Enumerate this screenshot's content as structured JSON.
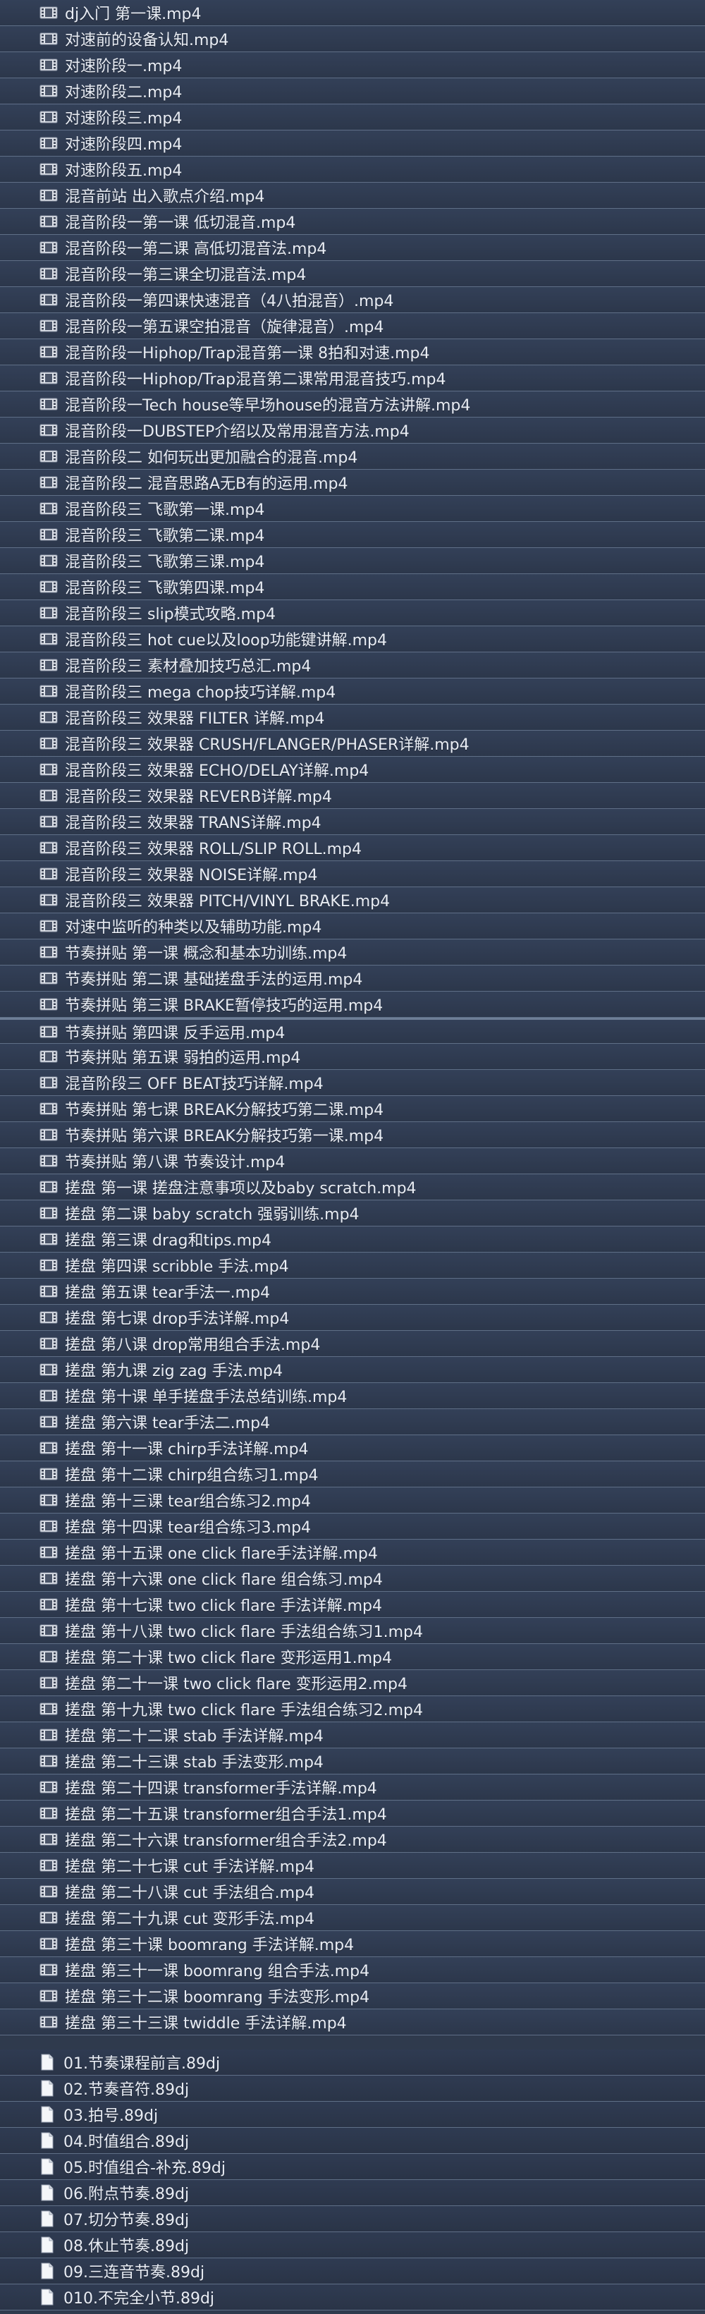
{
  "video_files": [
    {
      "name": "dj入门 第一课.mp4",
      "icon": "video-file-icon"
    },
    {
      "name": "对速前的设备认知.mp4",
      "icon": "video-file-icon"
    },
    {
      "name": "对速阶段一.mp4",
      "icon": "video-file-icon"
    },
    {
      "name": "对速阶段二.mp4",
      "icon": "video-file-icon"
    },
    {
      "name": "对速阶段三.mp4",
      "icon": "video-file-icon"
    },
    {
      "name": "对速阶段四.mp4",
      "icon": "video-file-icon"
    },
    {
      "name": "对速阶段五.mp4",
      "icon": "video-file-icon"
    },
    {
      "name": "混音前站 出入歌点介绍.mp4",
      "icon": "video-file-icon"
    },
    {
      "name": "混音阶段一第一课 低切混音.mp4",
      "icon": "video-file-icon"
    },
    {
      "name": "混音阶段一第二课 高低切混音法.mp4",
      "icon": "video-file-icon"
    },
    {
      "name": "混音阶段一第三课全切混音法.mp4",
      "icon": "video-file-icon"
    },
    {
      "name": "混音阶段一第四课快速混音（4八拍混音）.mp4",
      "icon": "video-file-icon"
    },
    {
      "name": "混音阶段一第五课空拍混音（旋律混音）.mp4",
      "icon": "video-file-icon"
    },
    {
      "name": "混音阶段一Hiphop/Trap混音第一课 8拍和对速.mp4",
      "icon": "video-file-icon"
    },
    {
      "name": "混音阶段一Hiphop/Trap混音第二课常用混音技巧.mp4",
      "icon": "video-file-icon"
    },
    {
      "name": "混音阶段一Tech house等早场house的混音方法讲解.mp4",
      "icon": "video-file-icon"
    },
    {
      "name": "混音阶段一DUBSTEP介绍以及常用混音方法.mp4",
      "icon": "video-file-icon"
    },
    {
      "name": "混音阶段二 如何玩出更加融合的混音.mp4",
      "icon": "video-file-icon"
    },
    {
      "name": "混音阶段二 混音思路A无B有的运用.mp4",
      "icon": "video-file-icon"
    },
    {
      "name": "混音阶段三 飞歌第一课.mp4",
      "icon": "video-file-icon"
    },
    {
      "name": "混音阶段三 飞歌第二课.mp4",
      "icon": "video-file-icon"
    },
    {
      "name": "混音阶段三 飞歌第三课.mp4",
      "icon": "video-file-icon"
    },
    {
      "name": "混音阶段三 飞歌第四课.mp4",
      "icon": "video-file-icon"
    },
    {
      "name": "混音阶段三 slip模式攻略.mp4",
      "icon": "video-file-icon"
    },
    {
      "name": "混音阶段三 hot cue以及loop功能键讲解.mp4",
      "icon": "video-file-icon"
    },
    {
      "name": "混音阶段三 素材叠加技巧总汇.mp4",
      "icon": "video-file-icon"
    },
    {
      "name": "混音阶段三 mega chop技巧详解.mp4",
      "icon": "video-file-icon"
    },
    {
      "name": "混音阶段三 效果器 FILTER 详解.mp4",
      "icon": "video-file-icon"
    },
    {
      "name": "混音阶段三 效果器 CRUSH/FLANGER/PHASER详解.mp4",
      "icon": "video-file-icon"
    },
    {
      "name": "混音阶段三 效果器 ECHO/DELAY详解.mp4",
      "icon": "video-file-icon"
    },
    {
      "name": "混音阶段三 效果器 REVERB详解.mp4",
      "icon": "video-file-icon"
    },
    {
      "name": "混音阶段三 效果器 TRANS详解.mp4",
      "icon": "video-file-icon"
    },
    {
      "name": "混音阶段三 效果器 ROLL/SLIP ROLL.mp4",
      "icon": "video-file-icon"
    },
    {
      "name": "混音阶段三 效果器 NOISE详解.mp4",
      "icon": "video-file-icon"
    },
    {
      "name": "混音阶段三 效果器 PITCH/VINYL BRAKE.mp4",
      "icon": "video-file-icon"
    },
    {
      "name": "对速中监听的种类以及辅助功能.mp4",
      "icon": "video-file-icon"
    },
    {
      "name": "节奏拼贴 第一课 概念和基本功训练.mp4",
      "icon": "video-file-icon"
    },
    {
      "name": "节奏拼贴 第二课 基础搓盘手法的运用.mp4",
      "icon": "video-file-icon"
    },
    {
      "name": "节奏拼贴 第三课 BRAKE暂停技巧的运用.mp4",
      "icon": "video-file-icon"
    },
    {
      "name": "节奏拼贴 第四课 反手运用.mp4",
      "icon": "video-file-icon"
    },
    {
      "name": "节奏拼贴 第五课 弱拍的运用.mp4",
      "icon": "video-file-icon"
    },
    {
      "name": "混音阶段三 OFF BEAT技巧详解.mp4",
      "icon": "video-file-icon"
    },
    {
      "name": "节奏拼贴 第七课 BREAK分解技巧第二课.mp4",
      "icon": "video-file-icon"
    },
    {
      "name": "节奏拼贴 第六课 BREAK分解技巧第一课.mp4",
      "icon": "video-file-icon"
    },
    {
      "name": "节奏拼贴 第八课 节奏设计.mp4",
      "icon": "video-file-icon"
    },
    {
      "name": "搓盘 第一课 搓盘注意事项以及baby scratch.mp4",
      "icon": "video-file-icon"
    },
    {
      "name": "搓盘 第二课 baby scratch 强弱训练.mp4",
      "icon": "video-file-icon"
    },
    {
      "name": "搓盘 第三课 drag和tips.mp4",
      "icon": "video-file-icon"
    },
    {
      "name": "搓盘 第四课 scribble 手法.mp4",
      "icon": "video-file-icon"
    },
    {
      "name": "搓盘 第五课 tear手法一.mp4",
      "icon": "video-file-icon"
    },
    {
      "name": "搓盘 第七课 drop手法详解.mp4",
      "icon": "video-file-icon"
    },
    {
      "name": "搓盘 第八课 drop常用组合手法.mp4",
      "icon": "video-file-icon"
    },
    {
      "name": "搓盘 第九课 zig zag 手法.mp4",
      "icon": "video-file-icon"
    },
    {
      "name": "搓盘 第十课 单手搓盘手法总结训练.mp4",
      "icon": "video-file-icon"
    },
    {
      "name": "搓盘 第六课 tear手法二.mp4",
      "icon": "video-file-icon"
    },
    {
      "name": "搓盘 第十一课 chirp手法详解.mp4",
      "icon": "video-file-icon"
    },
    {
      "name": "搓盘 第十二课 chirp组合练习1.mp4",
      "icon": "video-file-icon"
    },
    {
      "name": "搓盘 第十三课 tear组合练习2.mp4",
      "icon": "video-file-icon"
    },
    {
      "name": "搓盘 第十四课 tear组合练习3.mp4",
      "icon": "video-file-icon"
    },
    {
      "name": "搓盘 第十五课 one click flare手法详解.mp4",
      "icon": "video-file-icon"
    },
    {
      "name": "搓盘 第十六课 one click flare 组合练习.mp4",
      "icon": "video-file-icon"
    },
    {
      "name": "搓盘 第十七课 two click flare 手法详解.mp4",
      "icon": "video-file-icon"
    },
    {
      "name": "搓盘 第十八课 two click flare 手法组合练习1.mp4",
      "icon": "video-file-icon"
    },
    {
      "name": "搓盘 第二十课 two click flare 变形运用1.mp4",
      "icon": "video-file-icon"
    },
    {
      "name": "搓盘 第二十一课 two click flare 变形运用2.mp4",
      "icon": "video-file-icon"
    },
    {
      "name": "搓盘 第十九课 two click flare 手法组合练习2.mp4",
      "icon": "video-file-icon"
    },
    {
      "name": "搓盘 第二十二课 stab 手法详解.mp4",
      "icon": "video-file-icon"
    },
    {
      "name": "搓盘 第二十三课 stab 手法变形.mp4",
      "icon": "video-file-icon"
    },
    {
      "name": "搓盘 第二十四课 transformer手法详解.mp4",
      "icon": "video-file-icon"
    },
    {
      "name": "搓盘 第二十五课 transformer组合手法1.mp4",
      "icon": "video-file-icon"
    },
    {
      "name": "搓盘 第二十六课 transformer组合手法2.mp4",
      "icon": "video-file-icon"
    },
    {
      "name": "搓盘 第二十七课 cut 手法详解.mp4",
      "icon": "video-file-icon"
    },
    {
      "name": "搓盘 第二十八课 cut 手法组合.mp4",
      "icon": "video-file-icon"
    },
    {
      "name": "搓盘 第二十九课 cut 变形手法.mp4",
      "icon": "video-file-icon"
    },
    {
      "name": "搓盘 第三十课 boomrang 手法详解.mp4",
      "icon": "video-file-icon"
    },
    {
      "name": "搓盘 第三十一课 boomrang 组合手法.mp4",
      "icon": "video-file-icon"
    },
    {
      "name": "搓盘 第三十二课 boomrang 手法变形.mp4",
      "icon": "video-file-icon"
    },
    {
      "name": "搓盘 第三十三课 twiddle 手法详解.mp4",
      "icon": "video-file-icon"
    }
  ],
  "doc_files": [
    {
      "name": "01.节奏课程前言.89dj",
      "icon": "document-file-icon"
    },
    {
      "name": "02.节奏音符.89dj",
      "icon": "document-file-icon"
    },
    {
      "name": "03.拍号.89dj",
      "icon": "document-file-icon"
    },
    {
      "name": "04.时值组合.89dj",
      "icon": "document-file-icon"
    },
    {
      "name": "05.时值组合-补充.89dj",
      "icon": "document-file-icon"
    },
    {
      "name": "06.附点节奏.89dj",
      "icon": "document-file-icon"
    },
    {
      "name": "07.切分节奏.89dj",
      "icon": "document-file-icon"
    },
    {
      "name": "08.休止节奏.89dj",
      "icon": "document-file-icon"
    },
    {
      "name": "09.三连音节奏.89dj",
      "icon": "document-file-icon"
    },
    {
      "name": "010.不完全小节.89dj",
      "icon": "document-file-icon"
    }
  ],
  "colors": {
    "background": "#2f3a4d",
    "text": "#e9edf4",
    "divider": "#5f6f87"
  }
}
